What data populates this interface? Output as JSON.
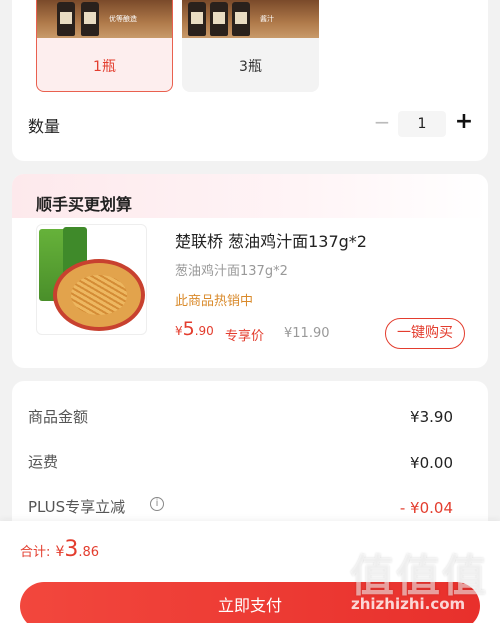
{
  "spec": {
    "options": [
      {
        "label": "1瓶",
        "selected": true
      },
      {
        "label": "3瓶",
        "selected": false
      }
    ],
    "image_tags": [
      "优等酿造",
      "酱汁",
      "原料",
      "匠心"
    ]
  },
  "quantity": {
    "label": "数量",
    "minus": "−",
    "value": "1",
    "plus": "+"
  },
  "addon": {
    "title": "顺手买更划算",
    "product": {
      "name": "楚联桥 葱油鸡汁面137g*2",
      "spec": "葱油鸡汁面137g*2",
      "hot": "此商品热销中",
      "price_symbol": "¥",
      "price_int": "5",
      "price_dec": ".90",
      "exclusive": "专享价",
      "original_price": "¥11.90",
      "buy_button": "一键购买"
    }
  },
  "summary": {
    "rows": [
      {
        "label": "商品金额",
        "value": "¥3.90"
      },
      {
        "label": "运费",
        "value": "¥0.00"
      },
      {
        "label": "PLUS专享立减",
        "value": "- ¥0.04"
      }
    ],
    "info_icon": "i"
  },
  "footer": {
    "total_label": "合计:",
    "total_symbol": "¥",
    "total_int": "3",
    "total_dec": ".86",
    "pay_button": "立即支付"
  },
  "watermark": {
    "logo": "值值值",
    "text": "zhizhizhi.com"
  },
  "colors": {
    "accent": "#e33d2e",
    "hot": "#d98a2b",
    "background": "#f2f2f2"
  }
}
